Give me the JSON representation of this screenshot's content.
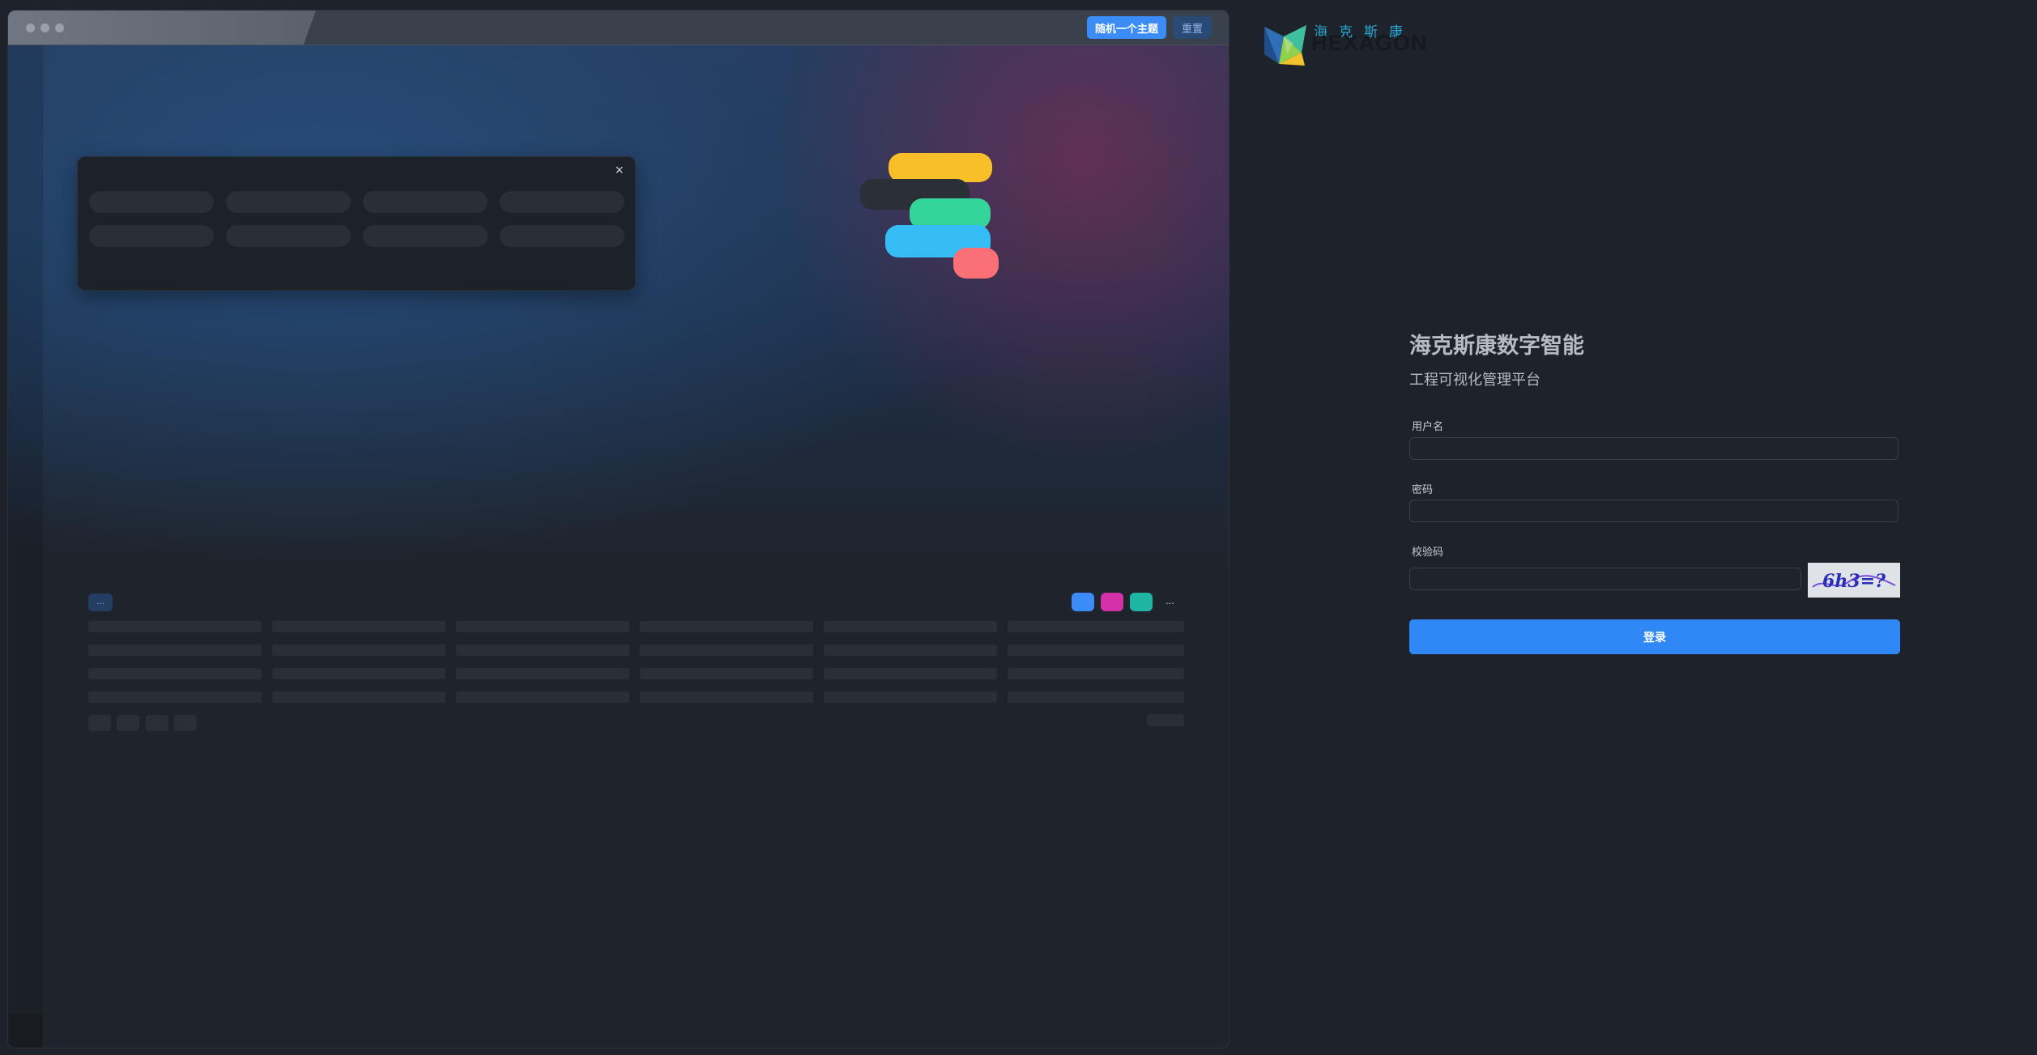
{
  "preview": {
    "random_theme_label": "随机一个主题",
    "reset_label": "重置",
    "close_glyph": "×",
    "toolbar_tag": "...",
    "toolbar_more": "...",
    "swatch_colors": [
      "#3b8cf7",
      "#d431a9",
      "#1fb5a4"
    ],
    "bubble_colors": [
      "#f8bf28",
      "#2b2f36",
      "#34d59a",
      "#36bdf6",
      "#fb7076"
    ]
  },
  "logo": {
    "chinese": "海克斯康",
    "english": "HEXAGON"
  },
  "login": {
    "title": "海克斯康数字智能",
    "subtitle": "工程可视化管理平台",
    "username_label": "用户名",
    "password_label": "密码",
    "captcha_label": "校验码",
    "captcha_text": "6h3=?",
    "submit_label": "登录"
  },
  "colors": {
    "page_bg": "#1e232b",
    "primary": "#2f88f5",
    "logo_cyan": "#29a8d6"
  }
}
